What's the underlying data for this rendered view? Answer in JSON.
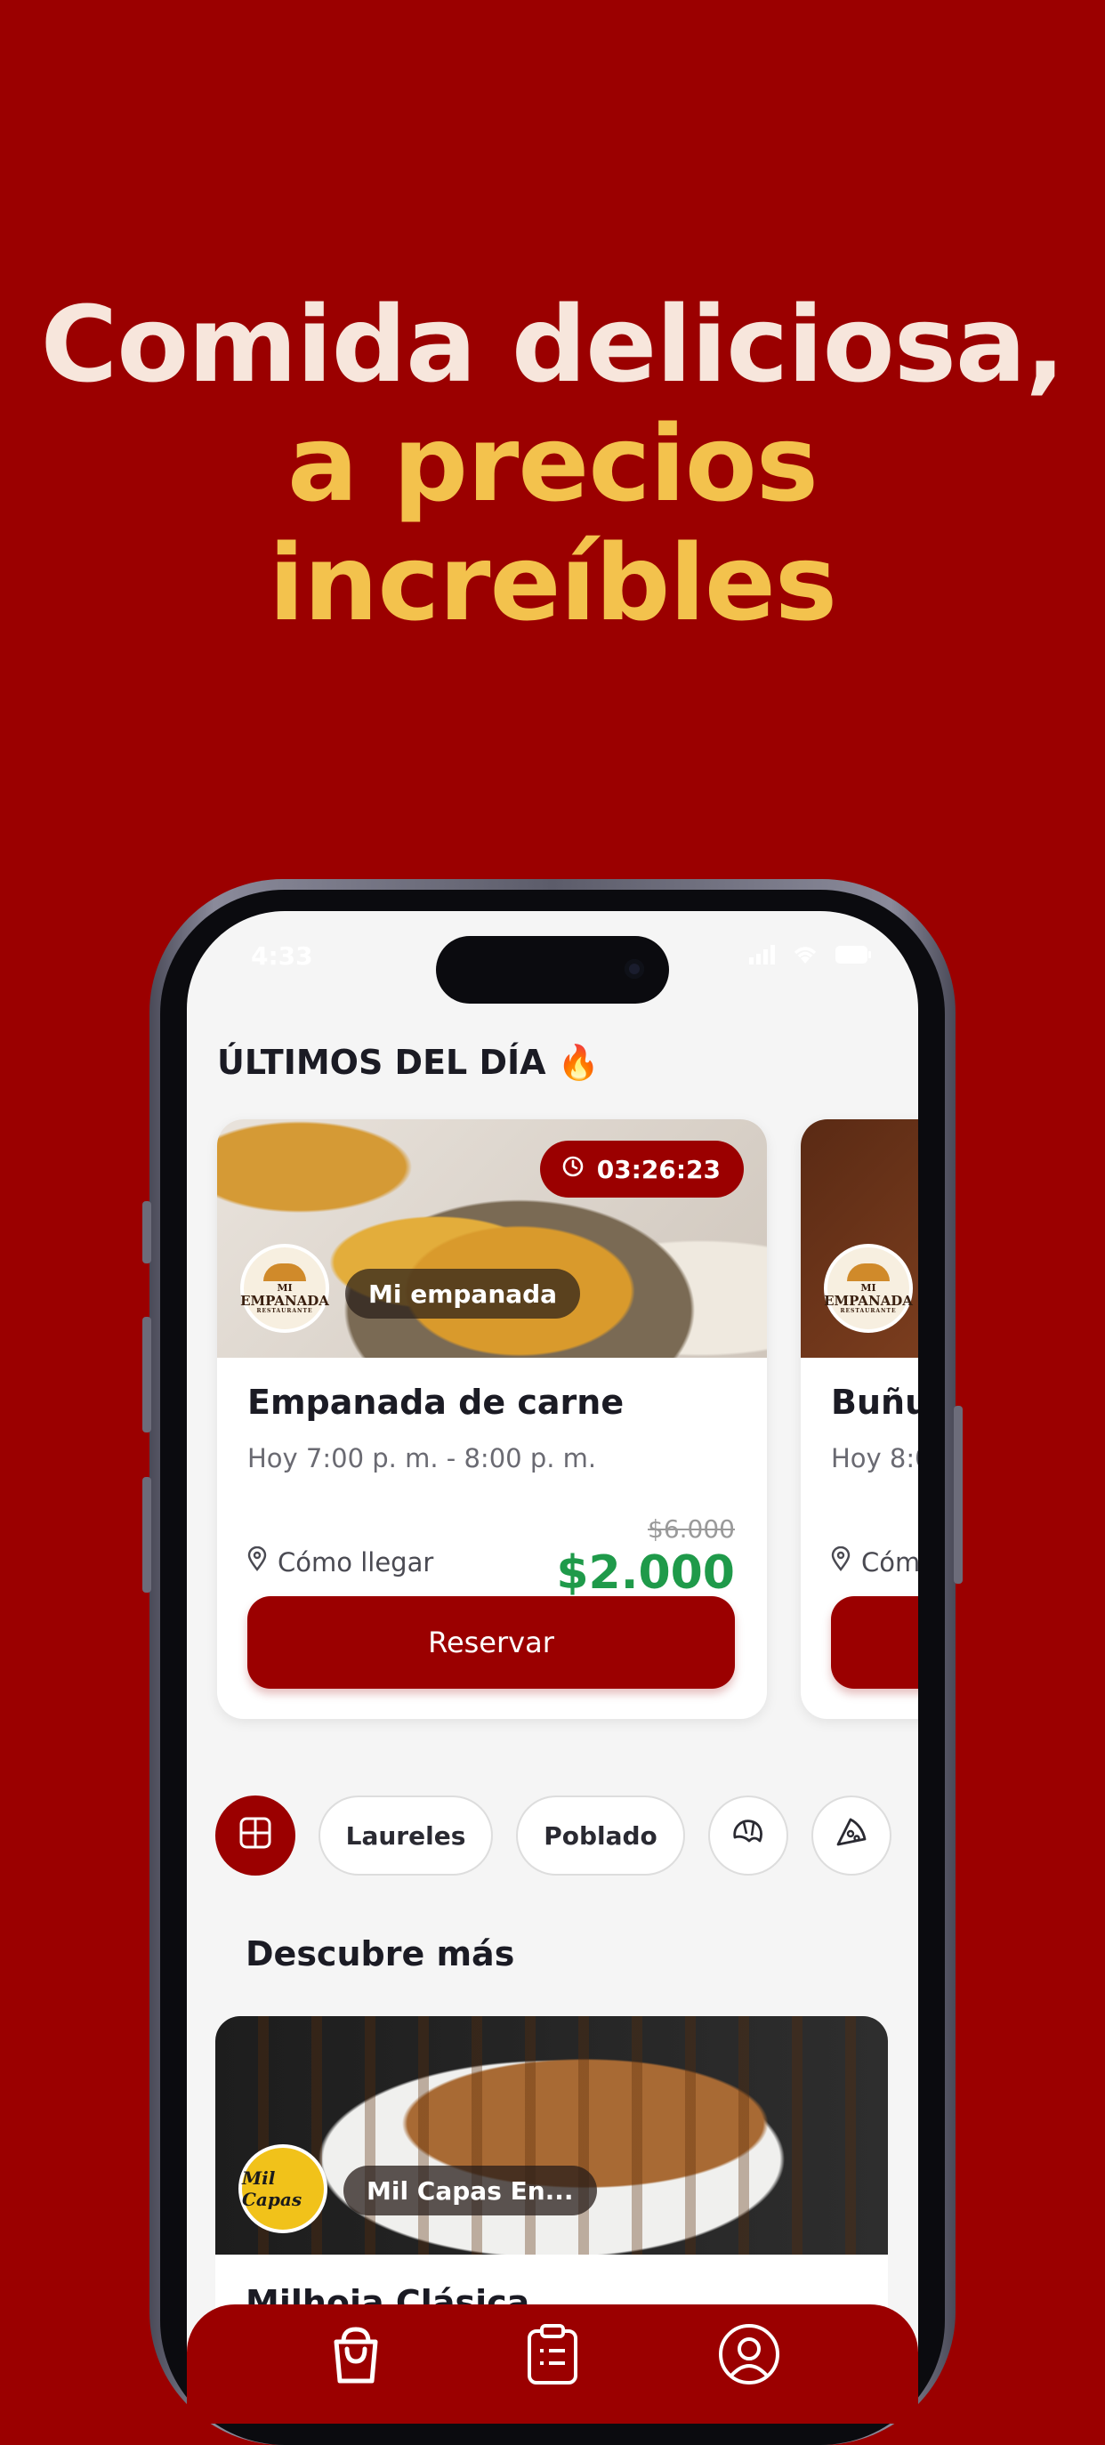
{
  "headline": {
    "line1": "Comida deliciosa,",
    "line2": "a precios",
    "line3": "increíbles"
  },
  "status_bar": {
    "time": "4:33"
  },
  "section_title": "ÚLTIMOS DEL DÍA 🔥",
  "deals": [
    {
      "timer": "03:26:23",
      "store": "Mi empanada",
      "logo_text": [
        "MI",
        "EMPANADA",
        "RESTAURANTE"
      ],
      "title": "Empanada de carne",
      "hours": "Hoy 7:00 p. m. - 8:00 p. m.",
      "directions": "Cómo llegar",
      "old_price": "$6.000",
      "price": "$2.000",
      "cta": "Reservar"
    },
    {
      "logo_text": [
        "MI",
        "EMPANADA",
        "RESTAURANTE"
      ],
      "title": "Buñu",
      "hours": "Hoy 8:0",
      "directions": "Cóm"
    }
  ],
  "filters": [
    {
      "type": "icon",
      "icon": "grid-icon",
      "active": true
    },
    {
      "type": "text",
      "label": "Laureles"
    },
    {
      "type": "text",
      "label": "Poblado"
    },
    {
      "type": "icon",
      "icon": "croissant-icon"
    },
    {
      "type": "icon",
      "icon": "pizza-icon"
    }
  ],
  "discover": {
    "title": "Descubre más",
    "store": "Mil Capas En...",
    "logo_text": "Mil Capas",
    "item_title": "Milhoja Clásica"
  },
  "tabbar": [
    "shopping-bag-icon",
    "clipboard-list-icon",
    "profile-icon"
  ],
  "colors": {
    "brand": "#9b0000",
    "accent": "#f3c24d",
    "price": "#1f9a4a"
  }
}
